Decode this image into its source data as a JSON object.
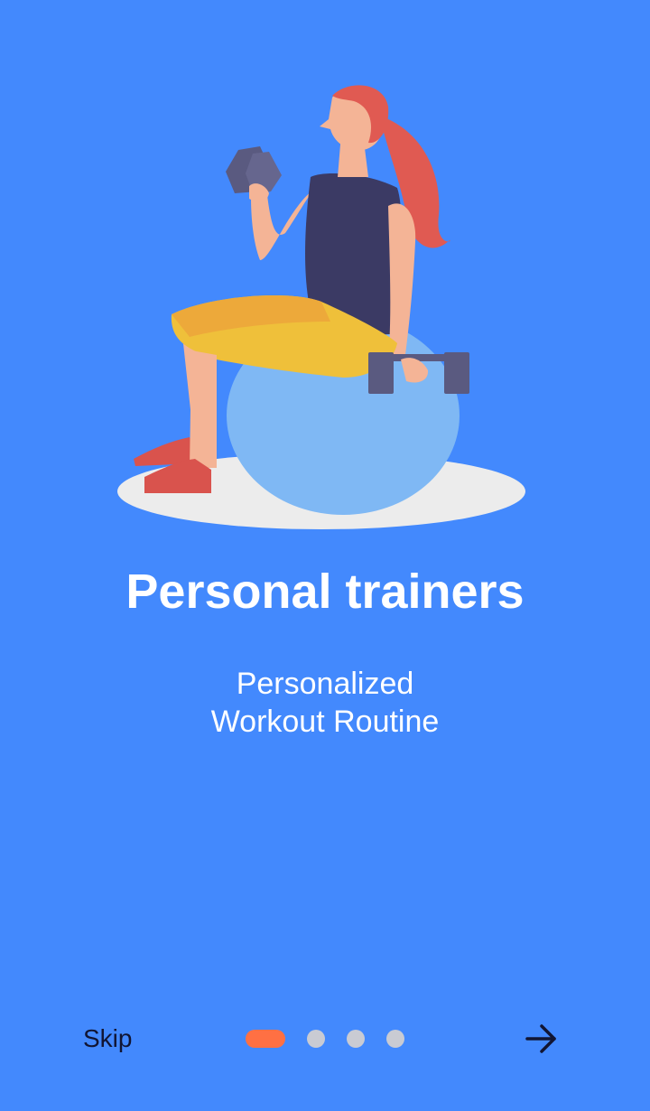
{
  "onboarding": {
    "title": "Personal trainers",
    "subtitle_line1": "Personalized",
    "subtitle_line2": "Workout Routine"
  },
  "footer": {
    "skip_label": "Skip",
    "pager": {
      "page_count": 4,
      "active_index": 0
    }
  },
  "colors": {
    "background": "#4389FD",
    "active_dot": "#FF7043",
    "inactive_dot": "#C9CBD3",
    "footer_text": "#111533"
  },
  "icons": {
    "next": "arrow-right-icon",
    "illustration": "woman-exercise-ball-dumbbells"
  }
}
